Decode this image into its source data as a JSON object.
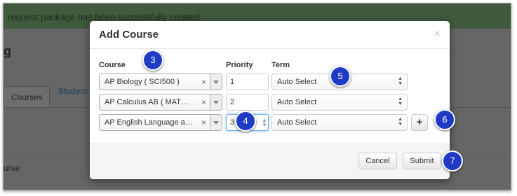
{
  "background": {
    "alert_text": "request package has been successfully created",
    "page_title": "g",
    "tabs": [
      "Courses",
      "Student"
    ],
    "course_text": "urse"
  },
  "modal": {
    "title": "Add Course",
    "close_symbol": "×",
    "columns": {
      "course": "Course",
      "priority": "Priority",
      "term": "Term"
    },
    "rows": [
      {
        "course": "AP Biology ( SCI500 )",
        "priority": "1",
        "term": "Auto Select"
      },
      {
        "course": "AP Calculus AB ( MAT…",
        "priority": "2",
        "term": "Auto Select"
      },
      {
        "course": "AP English Language a…",
        "priority": "3",
        "term": "Auto Select"
      }
    ],
    "clear_symbol": "×",
    "add_symbol": "+",
    "cancel_label": "Cancel",
    "submit_label": "Submit"
  },
  "callouts": [
    "3",
    "4",
    "5",
    "6",
    "7"
  ],
  "icons": {
    "close": "close-icon",
    "clear": "clear-icon",
    "dropdown": "chevron-down-icon",
    "updown": "updown-icon",
    "add": "plus-icon"
  },
  "colors": {
    "callout": "#1f3bc4",
    "focus": "#66afe9",
    "alert_bg": "#3f5a3c"
  }
}
